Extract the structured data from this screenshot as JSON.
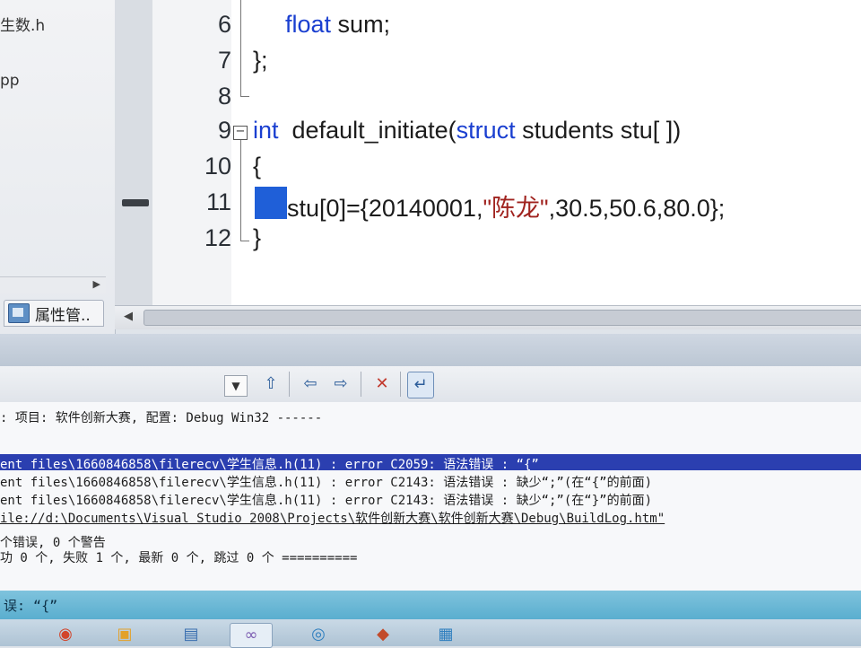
{
  "sidebar": {
    "items": [
      {
        "label": "生数.h"
      },
      {
        "label": "pp"
      }
    ],
    "properties_tab": "属性管.."
  },
  "editor": {
    "lines": [
      {
        "number": "6",
        "keyword": "float",
        "text": " sum;"
      },
      {
        "number": "7",
        "text": "};"
      },
      {
        "number": "8",
        "text": ""
      },
      {
        "number": "9",
        "keyword": "int",
        "text": "  default_initiate(",
        "keyword2": "struct",
        "text2": " students stu[ ])"
      },
      {
        "number": "10",
        "text": "{"
      },
      {
        "number": "11",
        "text_before": "stu[0]={20140001,",
        "string": "\"陈龙\"",
        "text_after": ",30.5,50.6,80.0};"
      },
      {
        "number": "12",
        "text": "}"
      }
    ]
  },
  "output": {
    "lines": [
      ": 项目: 软件创新大赛, 配置: Debug Win32 ------",
      "ent files\\1660846858\\filerecv\\学生信息.h(11) : error C2059: 语法错误 : “{”",
      "ent files\\1660846858\\filerecv\\学生信息.h(11) : error C2143: 语法错误 : 缺少“;”(在“{”的前面)",
      "ent files\\1660846858\\filerecv\\学生信息.h(11) : error C2143: 语法错误 : 缺少“;”(在“}”的前面)",
      "ile://d:\\Documents\\Visual Studio 2008\\Projects\\软件创新大赛\\软件创新大赛\\Debug\\BuildLog.htm\"",
      "个错误, 0 个警告",
      "功 0 个, 失败 1 个, 最新 0 个, 跳过 0 个 =========="
    ]
  },
  "status": {
    "text": "误: “{”"
  },
  "icons": {
    "combo_arrow": "chevron-down-icon",
    "toolbar": [
      "go-to-location-icon",
      "previous-message-icon",
      "next-message-icon",
      "clear-all-icon",
      "toggle-word-wrap-icon"
    ]
  },
  "colors": {
    "keyword": "#1a3fd0",
    "string": "#a0231f",
    "error_highlight": "#2b3fb0",
    "cursor_block": "#1f5fd8",
    "status_bar": "#5aaecf"
  }
}
